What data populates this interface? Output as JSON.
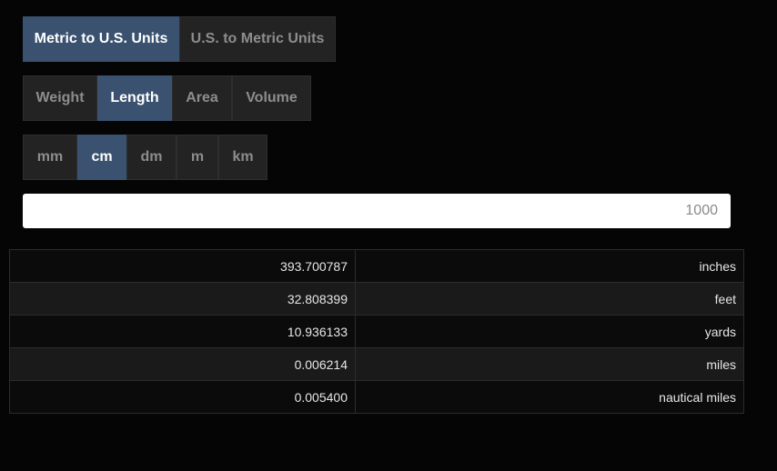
{
  "direction_tabs": [
    {
      "label": "Metric to U.S. Units",
      "active": true
    },
    {
      "label": "U.S. to Metric Units",
      "active": false
    }
  ],
  "category_tabs": [
    {
      "label": "Weight",
      "active": false
    },
    {
      "label": "Length",
      "active": true
    },
    {
      "label": "Area",
      "active": false
    },
    {
      "label": "Volume",
      "active": false
    }
  ],
  "unit_tabs": [
    {
      "label": "mm",
      "active": false
    },
    {
      "label": "cm",
      "active": true
    },
    {
      "label": "dm",
      "active": false
    },
    {
      "label": "m",
      "active": false
    },
    {
      "label": "km",
      "active": false
    }
  ],
  "input": {
    "value": "1000"
  },
  "results": [
    {
      "value": "393.700787",
      "unit": "inches"
    },
    {
      "value": "32.808399",
      "unit": "feet"
    },
    {
      "value": "10.936133",
      "unit": "yards"
    },
    {
      "value": "0.006214",
      "unit": "miles"
    },
    {
      "value": "0.005400",
      "unit": "nautical miles"
    }
  ],
  "colors": {
    "background": "#050505",
    "active_tab": "#3a5270",
    "inactive_tab": "#232323"
  }
}
